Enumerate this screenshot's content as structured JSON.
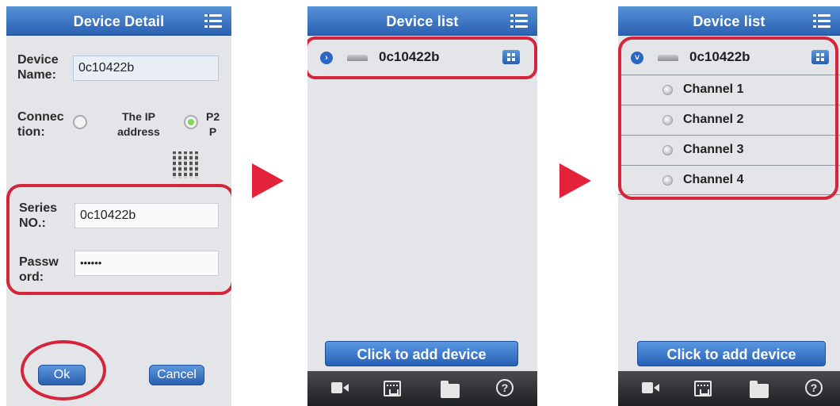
{
  "detail_screen": {
    "title": "Device Detail",
    "device_name_label": [
      "Device",
      "Name:"
    ],
    "device_name_value": "0c10422b",
    "connection_label": [
      "Connec",
      "tion:"
    ],
    "option_ip": [
      "The IP",
      "address"
    ],
    "option_p2p": [
      "P2",
      "P"
    ],
    "selected_option": "P2P",
    "series_label": [
      "Series",
      "NO.:"
    ],
    "series_value": "0c10422b",
    "password_label": [
      "Passw",
      "ord:"
    ],
    "password_value": "••••••",
    "ok_label": "Ok",
    "cancel_label": "Cancel"
  },
  "list_screen": {
    "title": "Device list",
    "device_name": "0c10422b",
    "add_button_label": "Click to add device"
  },
  "expanded_screen": {
    "title": "Device list",
    "device_name": "0c10422b",
    "channels": [
      "Channel 1",
      "Channel 2",
      "Channel 3",
      "Channel 4"
    ],
    "add_button_label": "Click to add device"
  },
  "icons": {
    "menu": "menu-icon",
    "qr": "qr-code-icon",
    "expand": "expand-arrow-icon",
    "dvr": "dvr-device-icon",
    "grid": "grid-icon",
    "bottom": [
      "video-icon",
      "record-icon",
      "folder-icon",
      "help-icon"
    ]
  },
  "colors": {
    "titlebar": "#2c62b3",
    "highlight": "#d4253a",
    "arrow": "#e2233a",
    "radio_on": "#7ed957"
  }
}
